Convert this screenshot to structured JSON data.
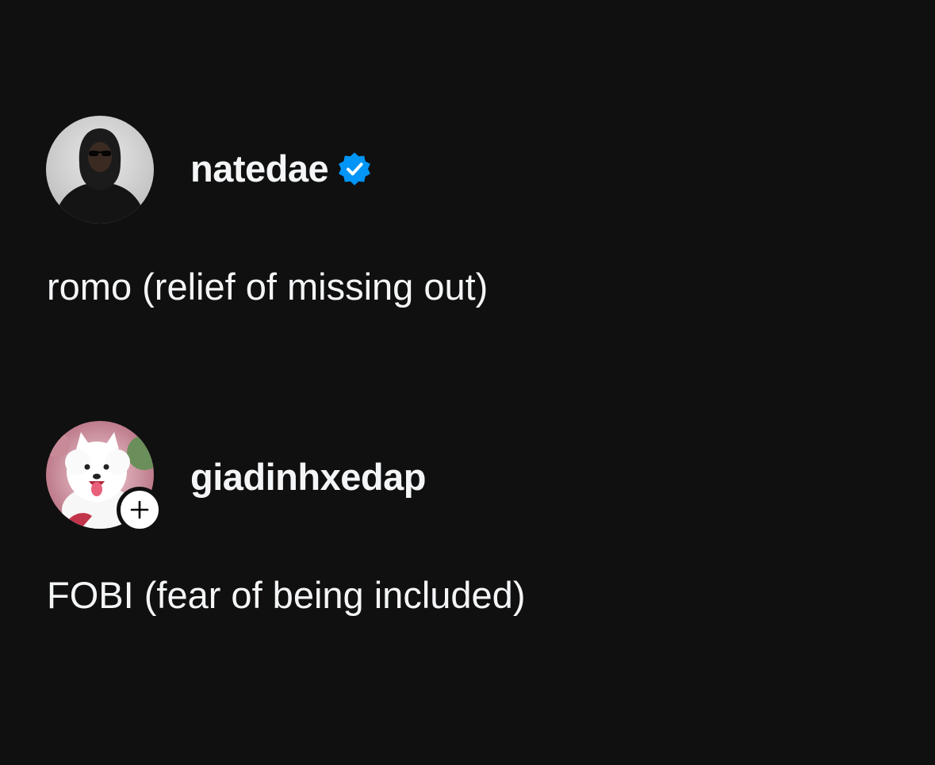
{
  "posts": [
    {
      "username": "natedae",
      "verified": true,
      "avatar_icon": "person-hooded-avatar",
      "text": "romo (relief of missing out)"
    },
    {
      "username": "giadinhxedap",
      "verified": false,
      "avatar_icon": "white-dog-avatar",
      "follow_badge_icon": "plus-icon",
      "text": "FOBI (fear of being included)"
    }
  ],
  "colors": {
    "background": "#101010",
    "text": "#f3f5f7",
    "verified_blue": "#0095f6"
  }
}
